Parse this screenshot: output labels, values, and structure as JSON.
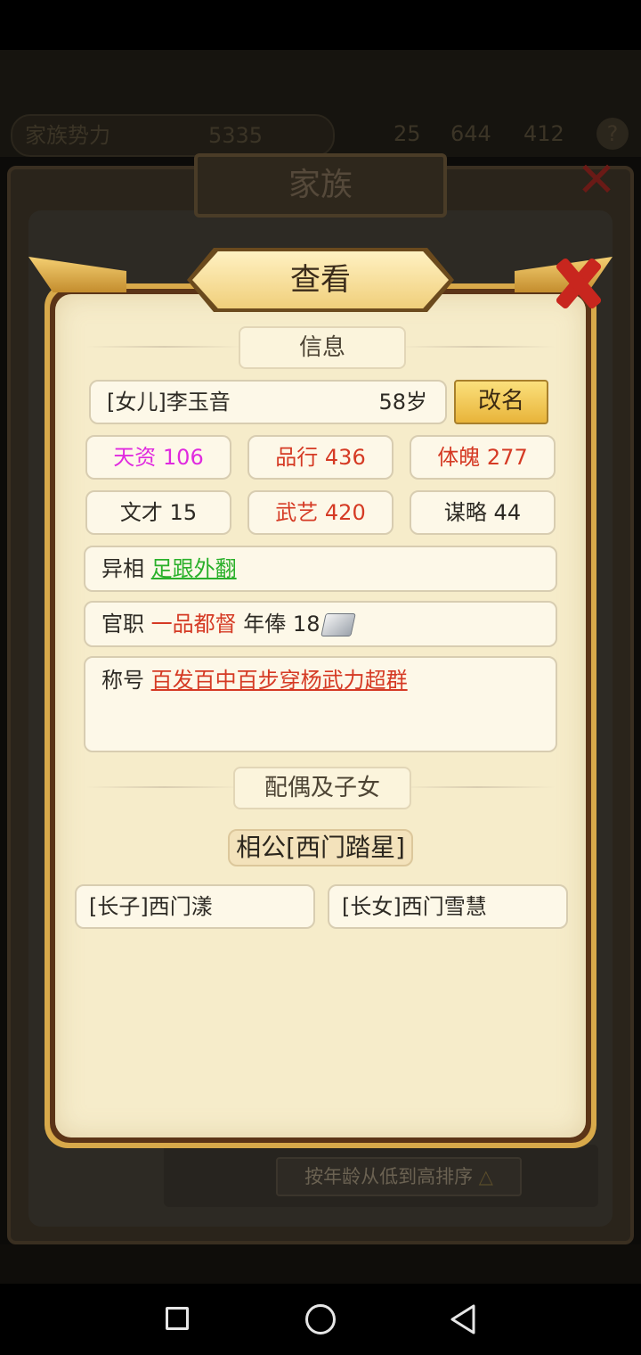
{
  "background": {
    "resources": {
      "family_power_label": "家族势力",
      "family_power_value": "5335",
      "res_a": "25",
      "res_b": "644",
      "res_c": "412"
    },
    "panel_title": "家族",
    "sort_button": "按年龄从低到高排序"
  },
  "dialog": {
    "title": "查看",
    "info_section": "信息",
    "name": "[女儿]李玉音",
    "age": "58岁",
    "rename_button": "改名",
    "stats": [
      {
        "label": "天资",
        "value": "106"
      },
      {
        "label": "品行",
        "value": "436"
      },
      {
        "label": "体魄",
        "value": "277"
      },
      {
        "label": "文才",
        "value": "15"
      },
      {
        "label": "武艺",
        "value": "420"
      },
      {
        "label": "谋略",
        "value": "44"
      }
    ],
    "trait_label": "异相",
    "trait_value": "足跟外翻",
    "office_label": "官职",
    "office_value": "一品都督",
    "salary_label": "年俸",
    "salary_value": "18",
    "honor_label": "称号",
    "honor_value": "百发百中百步穿杨武力超群",
    "family_section": "配偶及子女",
    "spouse": "相公[西门踏星]",
    "children": [
      "[长子]西门漾",
      "[长女]西门雪慧"
    ]
  },
  "colors": {
    "pink_stat": "#e02adf",
    "red_value": "#d53a24",
    "green_value": "#2ab02a",
    "panel_bg": "#f6ecca"
  }
}
